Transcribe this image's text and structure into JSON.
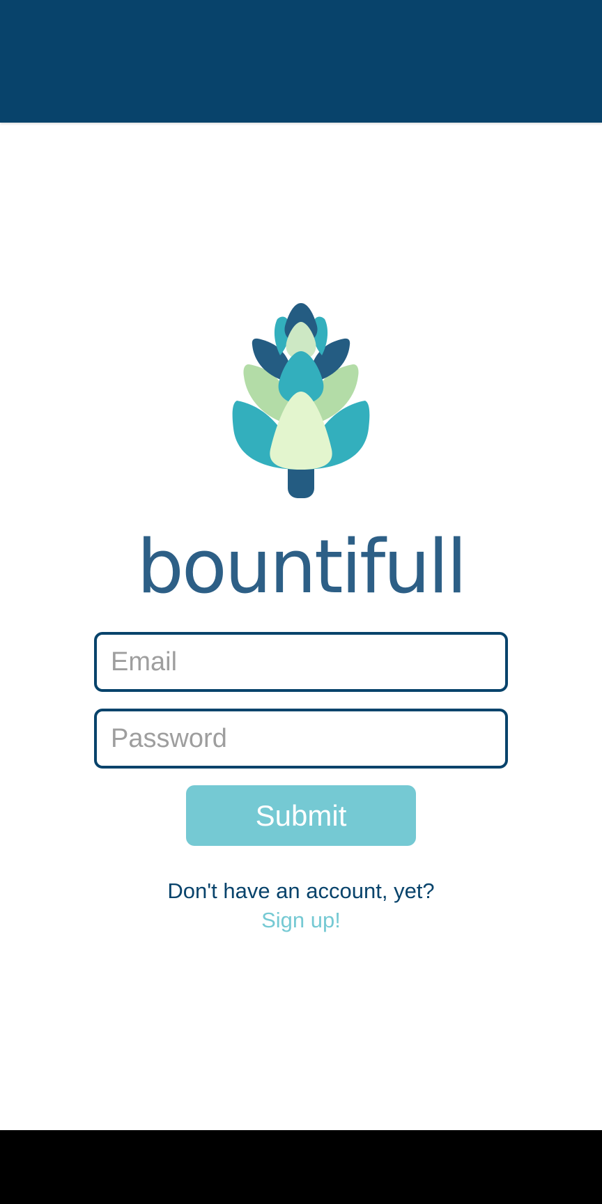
{
  "app": {
    "brand_name": "bountifull"
  },
  "login_form": {
    "email_placeholder": "Email",
    "email_value": "",
    "password_placeholder": "Password",
    "password_value": "",
    "submit_label": "Submit"
  },
  "signup_prompt": {
    "text": "Don't have an account, yet?",
    "link_label": "Sign up!"
  },
  "colors": {
    "header": "#08436b",
    "primary_dark": "#08436b",
    "accent": "#75c9d3",
    "wordmark": "#2d5f86",
    "logo_teal": "#33afbd",
    "logo_dark": "#245c82",
    "logo_light_green": "#b3dca7",
    "logo_pale_green": "#e3f5ce",
    "nav_bar": "#000000"
  },
  "icons": {
    "logo": "artichoke-logo-icon"
  }
}
